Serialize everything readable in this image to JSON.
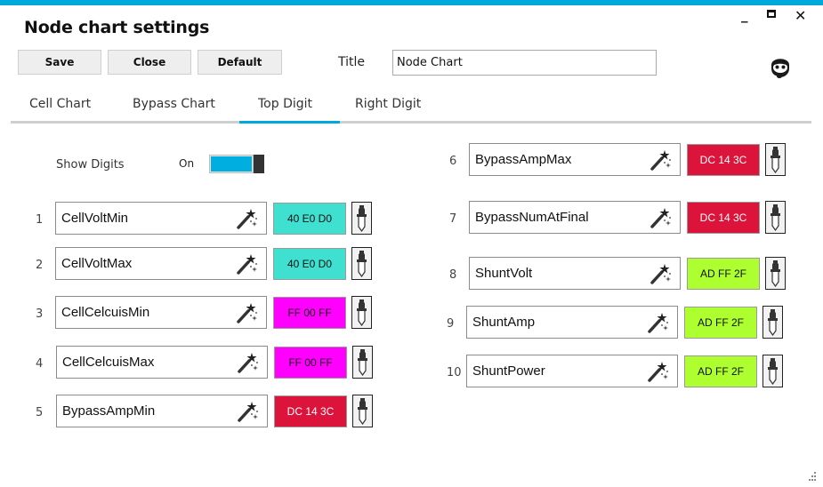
{
  "window": {
    "title": "Node chart settings",
    "controls": {
      "minimize": "_",
      "maximize": "□",
      "close": "✕"
    },
    "accent_color": "#00A9DB"
  },
  "toolbar": {
    "save_label": "Save",
    "close_label": "Close",
    "default_label": "Default",
    "title_label": "Title",
    "title_value": "Node Chart",
    "support_icon": "headset-support-icon"
  },
  "tabs": [
    {
      "label": "Cell Chart",
      "active": false
    },
    {
      "label": "Bypass Chart",
      "active": false
    },
    {
      "label": "Top Digit",
      "active": true
    },
    {
      "label": "Right Digit",
      "active": false
    }
  ],
  "show_digits": {
    "label": "Show Digits",
    "state_label": "On",
    "on": true
  },
  "digits": [
    {
      "num": "1",
      "name": "CellVoltMin",
      "color_hex": "40 E0 D0",
      "color": "#40E0D0",
      "text_color": "#111111"
    },
    {
      "num": "2",
      "name": "CellVoltMax",
      "color_hex": "40 E0 D0",
      "color": "#40E0D0",
      "text_color": "#111111"
    },
    {
      "num": "3",
      "name": "CellCelcuisMin",
      "color_hex": "FF 00 FF",
      "color": "#FF00FF",
      "text_color": "#111111"
    },
    {
      "num": "4",
      "name": "CellCelcuisMax",
      "color_hex": "FF 00 FF",
      "color": "#FF00FF",
      "text_color": "#111111"
    },
    {
      "num": "5",
      "name": "BypassAmpMin",
      "color_hex": "DC 14 3C",
      "color": "#DC143C",
      "text_color": "#FFFFFF"
    },
    {
      "num": "6",
      "name": "BypassAmpMax",
      "color_hex": "DC 14 3C",
      "color": "#DC143C",
      "text_color": "#FFFFFF"
    },
    {
      "num": "7",
      "name": "BypassNumAtFinal",
      "color_hex": "DC 14 3C",
      "color": "#DC143C",
      "text_color": "#FFFFFF"
    },
    {
      "num": "8",
      "name": "ShuntVolt",
      "color_hex": "AD FF 2F",
      "color": "#ADFF2F",
      "text_color": "#111111"
    },
    {
      "num": "9",
      "name": "ShuntAmp",
      "color_hex": "AD FF 2F",
      "color": "#ADFF2F",
      "text_color": "#111111"
    },
    {
      "num": "10",
      "name": "ShuntPower",
      "color_hex": "AD FF 2F",
      "color": "#ADFF2F",
      "text_color": "#111111"
    }
  ]
}
